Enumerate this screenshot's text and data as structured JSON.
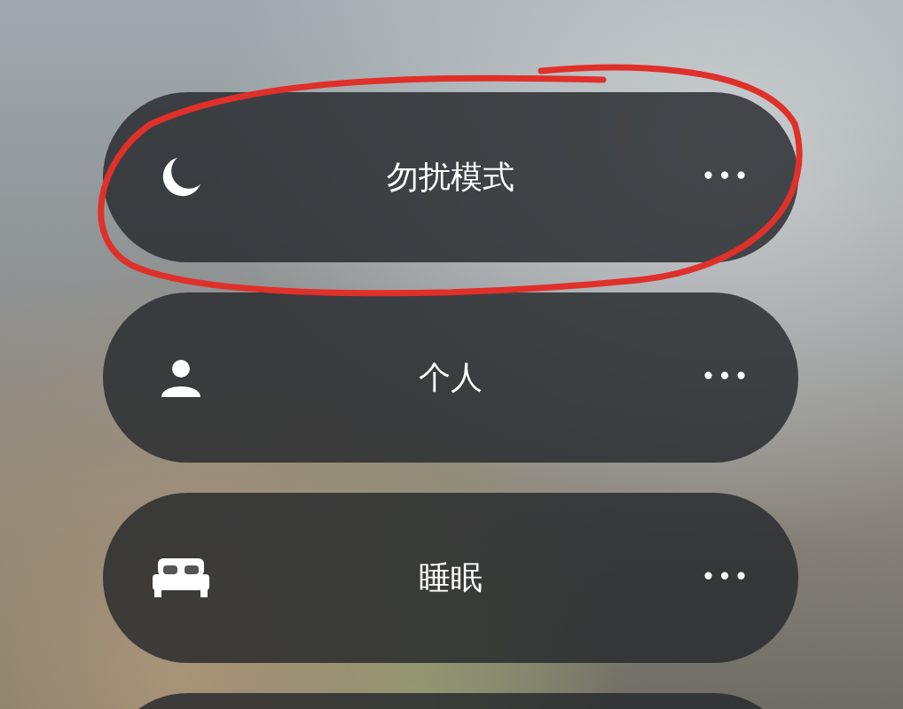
{
  "focus_modes": [
    {
      "kind": "moon",
      "label": "勿扰模式",
      "more": "•••"
    },
    {
      "kind": "person",
      "label": "个人",
      "more": "•••"
    },
    {
      "kind": "bed",
      "label": "睡眠",
      "more": "•••"
    }
  ],
  "annotation": {
    "kind": "circle"
  }
}
